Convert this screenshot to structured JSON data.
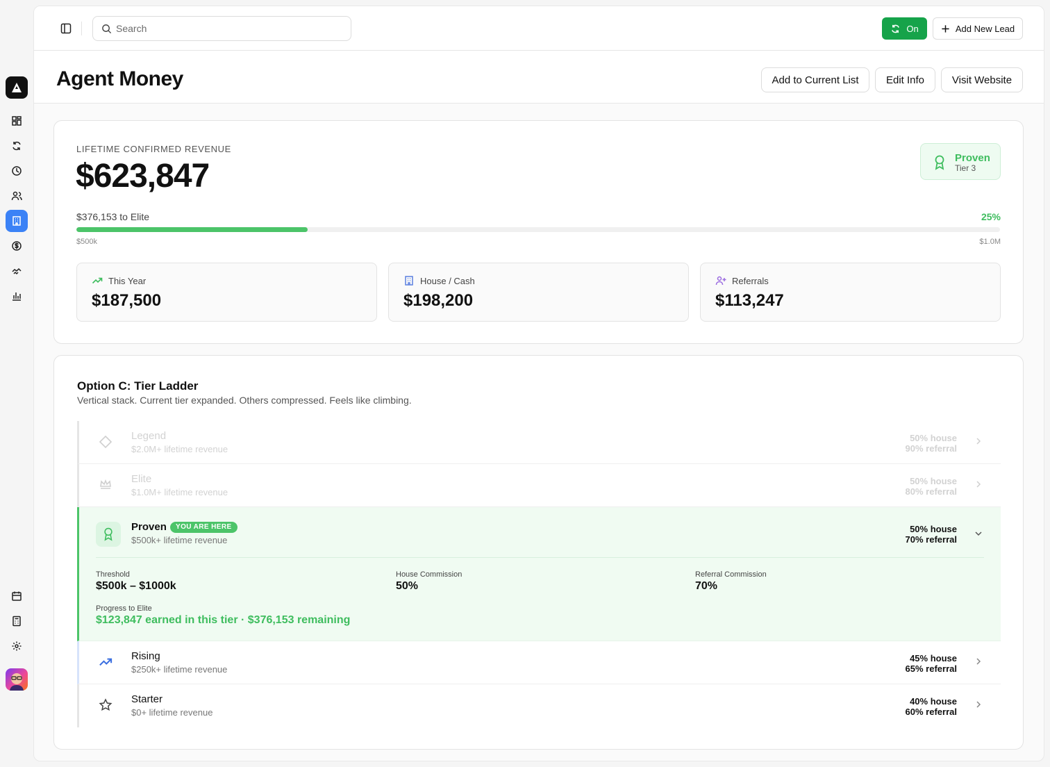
{
  "topbar": {
    "search_placeholder": "Search",
    "sync_label": "On",
    "add_lead_label": "Add New Lead"
  },
  "header": {
    "title": "Agent Money",
    "buttons": [
      "Add to Current List",
      "Edit Info",
      "Visit Website"
    ]
  },
  "revenue": {
    "label": "LIFETIME CONFIRMED REVENUE",
    "amount": "$623,847",
    "tier_name": "Proven",
    "tier_level": "Tier 3",
    "to_next": "$376,153 to Elite",
    "percent_label": "25%",
    "progress_fraction": 0.25,
    "range_start": "$500k",
    "range_end": "$1.0M",
    "stats": [
      {
        "label": "This Year",
        "value": "$187,500",
        "icon": "trending-up-icon"
      },
      {
        "label": "House / Cash",
        "value": "$198,200",
        "icon": "building-icon"
      },
      {
        "label": "Referrals",
        "value": "$113,247",
        "icon": "user-plus-icon"
      }
    ]
  },
  "ladder": {
    "title": "Option C: Tier Ladder",
    "subtitle": "Vertical stack. Current tier expanded. Others compressed. Feels like climbing.",
    "tiers": [
      {
        "name": "Legend",
        "desc": "$2.0M+ lifetime revenue",
        "house": "50% house",
        "referral": "90% referral",
        "icon": "diamond-icon"
      },
      {
        "name": "Elite",
        "desc": "$1.0M+ lifetime revenue",
        "house": "50% house",
        "referral": "80% referral",
        "icon": "crown-icon"
      },
      {
        "name": "Proven",
        "desc": "$500k+ lifetime revenue",
        "house": "50% house",
        "referral": "70% referral",
        "icon": "award-icon",
        "badge": "YOU ARE HERE"
      },
      {
        "name": "Rising",
        "desc": "$250k+ lifetime revenue",
        "house": "45% house",
        "referral": "65% referral",
        "icon": "trending-up-icon"
      },
      {
        "name": "Starter",
        "desc": "$0+ lifetime revenue",
        "house": "40% house",
        "referral": "60% referral",
        "icon": "star-icon"
      }
    ],
    "current_details": {
      "threshold_label": "Threshold",
      "threshold_value": "$500k – $1000k",
      "house_label": "House Commission",
      "house_value": "50%",
      "referral_label": "Referral Commission",
      "referral_value": "70%",
      "progress_label": "Progress to Elite",
      "progress_value": "$123,847 earned in this tier · $376,153 remaining"
    }
  },
  "colors": {
    "accent_green": "#4cc469",
    "button_green": "#16a34a",
    "active_blue": "#3b82f6"
  }
}
